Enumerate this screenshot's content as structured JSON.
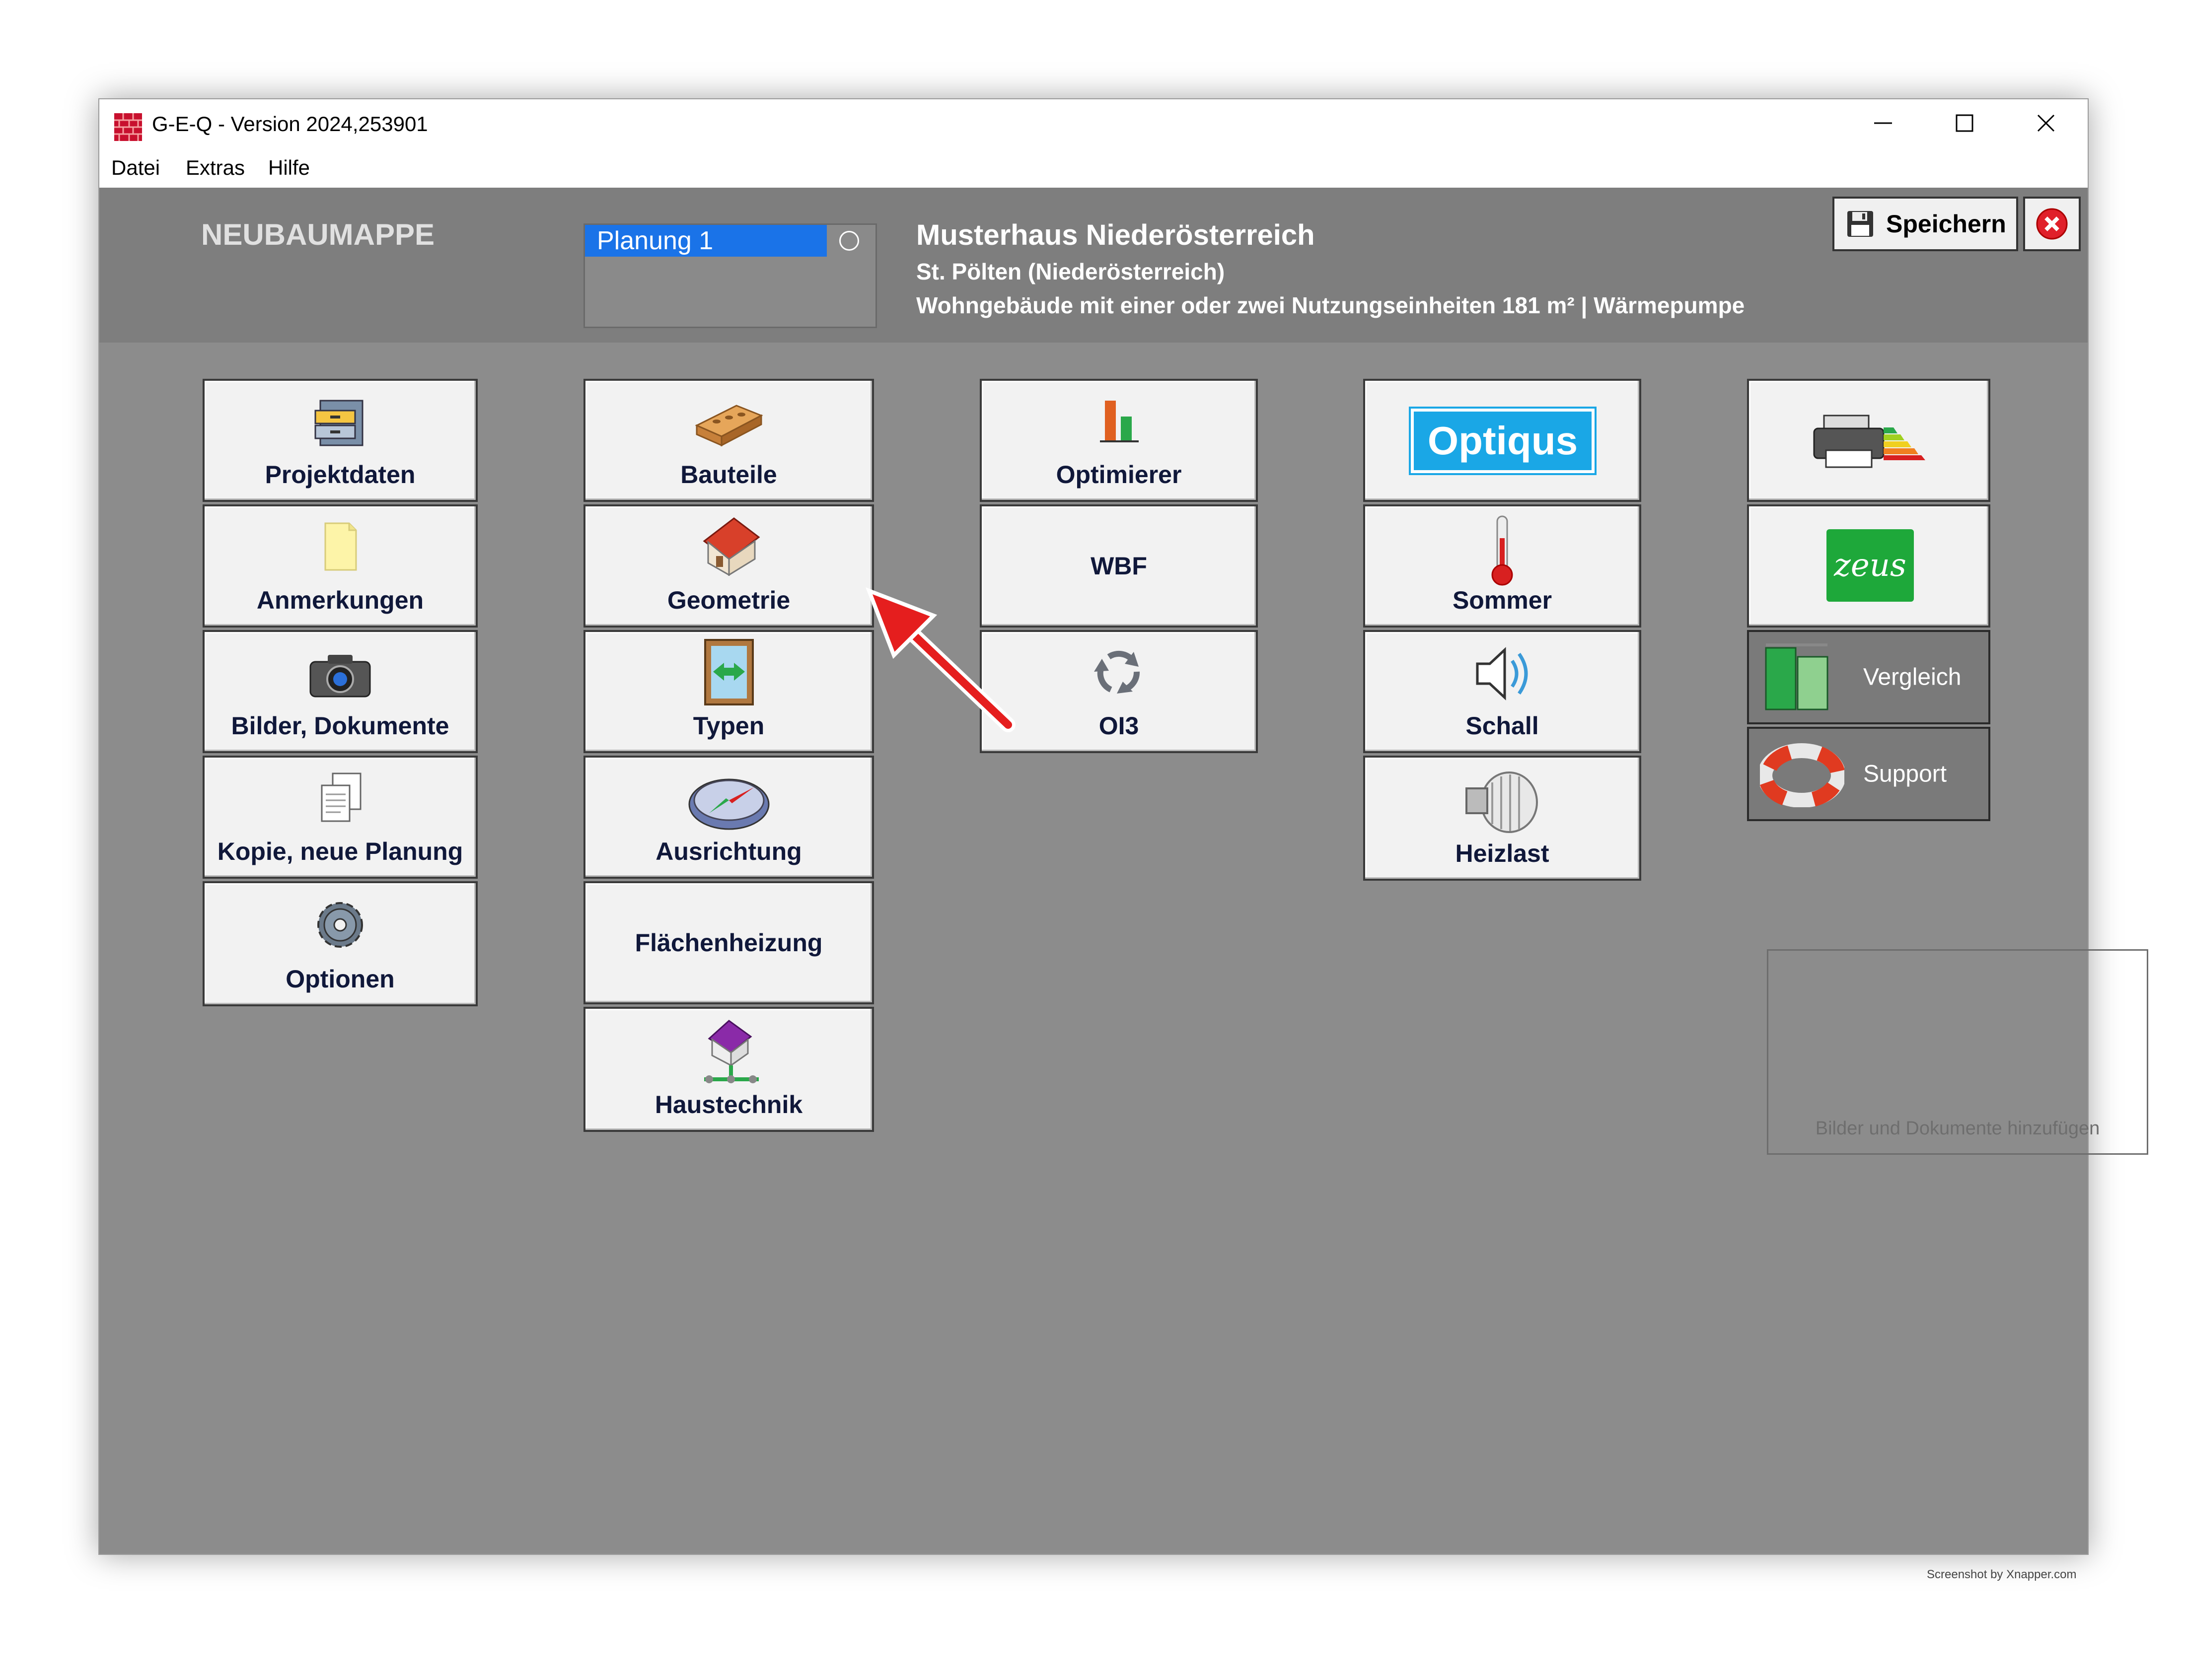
{
  "window": {
    "title": "G-E-Q - Version 2024,253901",
    "controls": {
      "minimize": "—",
      "maximize": "☐",
      "close": "✕"
    }
  },
  "menu": [
    "Datei",
    "Extras",
    "Hilfe"
  ],
  "header": {
    "section_title": "NEUBAUMAPPE",
    "planning": {
      "selected": "Planung 1"
    },
    "project_name": "Musterhaus Niederösterreich",
    "location": "St. Pölten (Niederösterreich)",
    "building_info": "Wohngebäude mit einer oder zwei Nutzungseinheiten  181 m²  |  Wärmepumpe",
    "save_label": "Speichern"
  },
  "columns": {
    "col1": [
      "Projektdaten",
      "Anmerkungen",
      "Bilder, Dokumente",
      "Kopie, neue Planung",
      "Optionen"
    ],
    "col2": [
      "Bauteile",
      "Geometrie",
      "Typen",
      "Ausrichtung",
      "Flächenheizung",
      "Haustechnik"
    ],
    "col3": [
      "Optimierer",
      "WBF",
      "OI3"
    ],
    "col4": {
      "logo_optiqus": "Optiqus",
      "items": [
        "Sommer",
        "Schall",
        "Heizlast"
      ]
    },
    "col5": {
      "zeus_logo": "zeus",
      "vergleich": "Vergleich",
      "support": "Support"
    }
  },
  "drop_zone": "Bilder und Dokumente hinzufügen",
  "watermark": "Screenshot by Xnapper.com",
  "colors": {
    "accent_blue": "#1a73e8",
    "zeus_green": "#1ea83a",
    "optiqus_blue": "#1aa7e6",
    "arrow_red": "#e51e1e"
  }
}
